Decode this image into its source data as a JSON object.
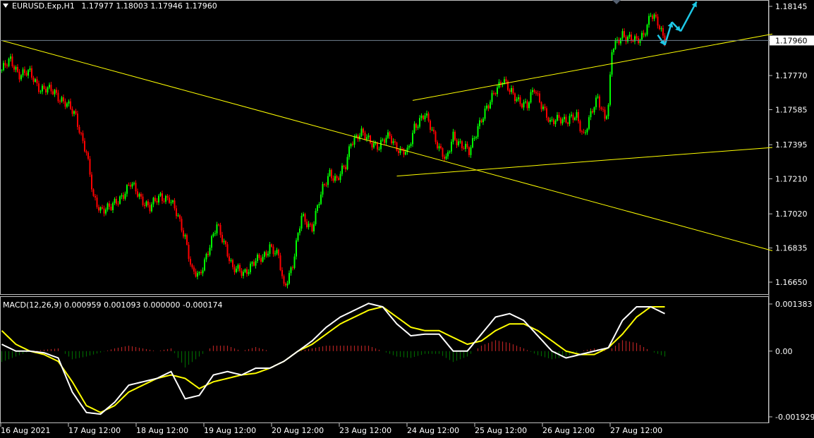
{
  "header": {
    "symbol_text": "EURUSD.Exp,H1",
    "ohlc_text": "1.17977 1.18003 1.17946 1.17960"
  },
  "macd_header": "MACD(12,26,9) 0.000959 0.001093 0.000000 -0.000174",
  "price_marker_label": "1.17960",
  "colors": {
    "background": "#000000",
    "bull_candle": "#00ff00",
    "bear_candle": "#ff0000",
    "trendline": "#ffff00",
    "macd_line": "#ffffff",
    "signal_line": "#ffff00",
    "hist_positive": "#b22222",
    "hist_negative": "#006400",
    "arrow": "#1ec8e6",
    "price_line": "#708090",
    "grid": "#c0c0c0"
  },
  "chart_data": [
    {
      "type": "candlestick",
      "symbol": "EURUSD.Exp",
      "timeframe": "H1",
      "ylim": [
        1.1658,
        1.1821
      ],
      "yticks": [
        "1.18145",
        "1.17960",
        "1.17770",
        "1.17585",
        "1.17395",
        "1.17210",
        "1.17020",
        "1.16835",
        "1.16650"
      ],
      "xticks": [
        "16 Aug 2021",
        "17 Aug 12:00",
        "18 Aug 12:00",
        "19 Aug 12:00",
        "20 Aug 12:00",
        "23 Aug 12:00",
        "24 Aug 12:00",
        "25 Aug 12:00",
        "26 Aug 12:00",
        "27 Aug 12:00"
      ],
      "current_price": 1.1796,
      "close_path": [
        [
          0,
          1.178
        ],
        [
          5,
          1.1785
        ],
        [
          10,
          1.1778
        ],
        [
          16,
          1.1778
        ],
        [
          22,
          1.177
        ],
        [
          30,
          1.1768
        ],
        [
          36,
          1.1762
        ],
        [
          42,
          1.1755
        ],
        [
          48,
          1.1735
        ],
        [
          52,
          1.171
        ],
        [
          56,
          1.1705
        ],
        [
          62,
          1.1705
        ],
        [
          68,
          1.1712
        ],
        [
          73,
          1.1718
        ],
        [
          78,
          1.1712
        ],
        [
          84,
          1.1705
        ],
        [
          90,
          1.1712
        ],
        [
          95,
          1.171
        ],
        [
          100,
          1.17
        ],
        [
          104,
          1.169
        ],
        [
          108,
          1.167
        ],
        [
          112,
          1.1668
        ],
        [
          116,
          1.168
        ],
        [
          122,
          1.1695
        ],
        [
          127,
          1.1685
        ],
        [
          131,
          1.1672
        ],
        [
          137,
          1.167
        ],
        [
          142,
          1.1675
        ],
        [
          148,
          1.1678
        ],
        [
          152,
          1.1685
        ],
        [
          157,
          1.1678
        ],
        [
          160,
          1.1662
        ],
        [
          165,
          1.1675
        ],
        [
          170,
          1.17
        ],
        [
          176,
          1.1695
        ],
        [
          182,
          1.1715
        ],
        [
          186,
          1.1725
        ],
        [
          190,
          1.172
        ],
        [
          195,
          1.1728
        ],
        [
          198,
          1.1742
        ],
        [
          204,
          1.1745
        ],
        [
          209,
          1.1742
        ],
        [
          214,
          1.1738
        ],
        [
          220,
          1.1745
        ],
        [
          226,
          1.1735
        ],
        [
          230,
          1.1735
        ],
        [
          234,
          1.175
        ],
        [
          240,
          1.1755
        ],
        [
          244,
          1.1748
        ],
        [
          248,
          1.1738
        ],
        [
          252,
          1.173
        ],
        [
          256,
          1.1745
        ],
        [
          260,
          1.174
        ],
        [
          265,
          1.1735
        ],
        [
          270,
          1.175
        ],
        [
          276,
          1.176
        ],
        [
          280,
          1.177
        ],
        [
          284,
          1.1775
        ],
        [
          288,
          1.1768
        ],
        [
          292,
          1.1765
        ],
        [
          298,
          1.176
        ],
        [
          302,
          1.177
        ],
        [
          307,
          1.176
        ],
        [
          311,
          1.175
        ],
        [
          316,
          1.1755
        ],
        [
          321,
          1.1752
        ],
        [
          326,
          1.1755
        ],
        [
          330,
          1.1745
        ],
        [
          334,
          1.1755
        ],
        [
          338,
          1.1765
        ],
        [
          342,
          1.1755
        ],
        [
          344,
          1.176
        ],
        [
          346,
          1.179
        ],
        [
          349,
          1.1795
        ],
        [
          352,
          1.18
        ],
        [
          356,
          1.1797
        ],
        [
          360,
          1.1795
        ],
        [
          364,
          1.18
        ],
        [
          368,
          1.181
        ],
        [
          372,
          1.1805
        ],
        [
          376,
          1.1797
        ]
      ],
      "annotation_lines": [
        {
          "name": "long-downtrend",
          "from": [
            0,
            1.1796
          ],
          "to": [
            437,
            1.1682
          ]
        },
        {
          "name": "channel-upper",
          "from": [
            233,
            1.17635
          ],
          "to": [
            437,
            1.17995
          ]
        },
        {
          "name": "channel-lower",
          "from": [
            224,
            1.17225
          ],
          "to": [
            437,
            1.1738
          ]
        }
      ],
      "forecast_arrows": [
        [
          [
            372,
            1.1799
          ],
          [
            376,
            1.17935
          ],
          [
            380,
            1.1806
          ],
          [
            385,
            1.1801
          ],
          [
            394,
            1.1817
          ]
        ]
      ]
    },
    {
      "type": "macd",
      "params": [
        12,
        26,
        9
      ],
      "title": "MACD(12,26,9)",
      "values": {
        "main": 0.000959,
        "signal": 0.001093,
        "v3": 0.0,
        "v4": -0.000174
      },
      "ylim": [
        -0.002,
        0.0015
      ],
      "yticks": [
        "0.001383",
        "0.00",
        "-0.001929"
      ],
      "macd_path": [
        [
          0,
          0.0002
        ],
        [
          8,
          0.0
        ],
        [
          16,
          0.0
        ],
        [
          24,
          -5e-05
        ],
        [
          32,
          -0.0002
        ],
        [
          40,
          -0.0012
        ],
        [
          48,
          -0.0018
        ],
        [
          56,
          -0.00185
        ],
        [
          64,
          -0.0015
        ],
        [
          72,
          -0.001
        ],
        [
          80,
          -0.0009
        ],
        [
          88,
          -0.0008
        ],
        [
          96,
          -0.0006
        ],
        [
          104,
          -0.0014
        ],
        [
          112,
          -0.0013
        ],
        [
          120,
          -0.0007
        ],
        [
          128,
          -0.0006
        ],
        [
          136,
          -0.0007
        ],
        [
          144,
          -0.0005
        ],
        [
          152,
          -0.0005
        ],
        [
          160,
          -0.0003
        ],
        [
          168,
          0.0
        ],
        [
          176,
          0.0003
        ],
        [
          184,
          0.0007
        ],
        [
          192,
          0.001
        ],
        [
          200,
          0.0012
        ],
        [
          208,
          0.0014
        ],
        [
          216,
          0.0013
        ],
        [
          224,
          0.0008
        ],
        [
          232,
          0.00045
        ],
        [
          240,
          0.0005
        ],
        [
          248,
          0.0005
        ],
        [
          256,
          0.0
        ],
        [
          264,
          0.0
        ],
        [
          272,
          0.0005
        ],
        [
          280,
          0.001
        ],
        [
          288,
          0.0011
        ],
        [
          296,
          0.0009
        ],
        [
          304,
          0.00045
        ],
        [
          312,
          0.0
        ],
        [
          320,
          -0.0002
        ],
        [
          328,
          -0.0001
        ],
        [
          336,
          0.0
        ],
        [
          344,
          0.0001
        ],
        [
          352,
          0.0009
        ],
        [
          360,
          0.0013
        ],
        [
          368,
          0.0013
        ],
        [
          376,
          0.0011
        ]
      ],
      "signal_path": [
        [
          0,
          0.0006
        ],
        [
          8,
          0.0002
        ],
        [
          16,
          0.0
        ],
        [
          24,
          -0.0001
        ],
        [
          32,
          -0.0003
        ],
        [
          40,
          -0.0009
        ],
        [
          48,
          -0.0016
        ],
        [
          56,
          -0.0018
        ],
        [
          64,
          -0.0016
        ],
        [
          72,
          -0.0012
        ],
        [
          80,
          -0.001
        ],
        [
          88,
          -0.0008
        ],
        [
          96,
          -0.0007
        ],
        [
          104,
          -0.0008
        ],
        [
          112,
          -0.0011
        ],
        [
          120,
          -0.0009
        ],
        [
          128,
          -0.0008
        ],
        [
          136,
          -0.0007
        ],
        [
          144,
          -0.00065
        ],
        [
          152,
          -0.0005
        ],
        [
          160,
          -0.0003
        ],
        [
          168,
          0.0
        ],
        [
          176,
          0.0002
        ],
        [
          184,
          0.0005
        ],
        [
          192,
          0.0008
        ],
        [
          200,
          0.001
        ],
        [
          208,
          0.0012
        ],
        [
          216,
          0.0013
        ],
        [
          224,
          0.001
        ],
        [
          232,
          0.0007
        ],
        [
          240,
          0.0006
        ],
        [
          248,
          0.0006
        ],
        [
          256,
          0.0004
        ],
        [
          264,
          0.0002
        ],
        [
          272,
          0.0003
        ],
        [
          280,
          0.0006
        ],
        [
          288,
          0.0008
        ],
        [
          296,
          0.0008
        ],
        [
          304,
          0.0006
        ],
        [
          312,
          0.0003
        ],
        [
          320,
          0.0
        ],
        [
          328,
          -0.0001
        ],
        [
          336,
          -0.0001
        ],
        [
          344,
          0.0001
        ],
        [
          352,
          0.0005
        ],
        [
          360,
          0.001
        ],
        [
          368,
          0.0013
        ],
        [
          376,
          0.0013
        ]
      ]
    }
  ]
}
